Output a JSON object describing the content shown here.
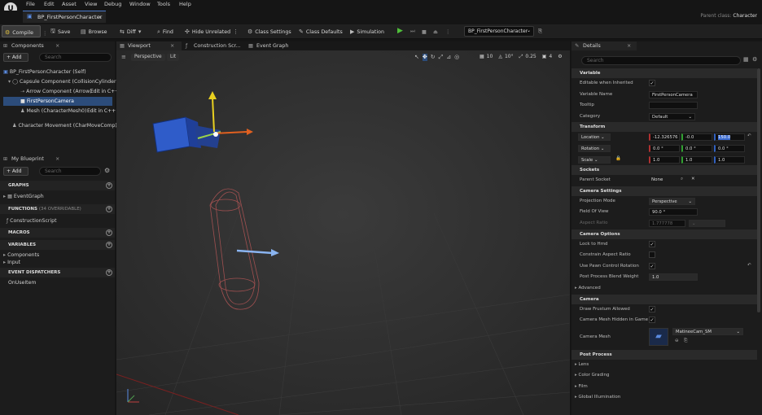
{
  "menu": [
    "File",
    "Edit",
    "Asset",
    "View",
    "Debug",
    "Window",
    "Tools",
    "Help"
  ],
  "doc_tab": {
    "label": "BP_FirstPersonCharacter",
    "close": "×"
  },
  "parent_class": {
    "label": "Parent class:",
    "value": "Character"
  },
  "toolbar": {
    "compile": "Compile",
    "save": "Save",
    "browse": "Browse",
    "diff": "Diff",
    "find": "Find",
    "hide_unrelated": "Hide Unrelated",
    "class_settings": "Class Settings",
    "class_defaults": "Class Defaults",
    "simulation": "Simulation",
    "debug_object": "BP_FirstPersonCharacter"
  },
  "components": {
    "tab": "Components",
    "add": "+ Add",
    "search_placeholder": "Search",
    "items": [
      {
        "label": "BP_FirstPersonCharacter (Self)"
      },
      {
        "label": "Capsule Component (CollisionCylinder)"
      },
      {
        "label": "Arrow Component (Arrow)",
        "link": "Edit in C++"
      },
      {
        "label": "FirstPersonCamera"
      },
      {
        "label": "Mesh (CharacterMesh0)",
        "link": "Edit in C++"
      },
      {
        "label": "Character Movement (CharMoveComp)"
      }
    ]
  },
  "my_blueprint": {
    "tab": "My Blueprint",
    "add": "+ Add",
    "search_placeholder": "Search",
    "graphs": "GRAPHS",
    "event_graph": "EventGraph",
    "functions": "FUNCTIONS",
    "functions_note": "(34 OVERRIDABLE)",
    "construction_script": "ConstructionScript",
    "macros": "MACROS",
    "variables": "VARIABLES",
    "components": "Components",
    "input": "Input",
    "event_dispatchers": "EVENT DISPATCHERS",
    "on_use_item": "OnUseItem"
  },
  "center_tabs": {
    "viewport": "Viewport",
    "construction": "Construction Scr...",
    "event_graph": "Event Graph"
  },
  "viewport": {
    "perspective": "Perspective",
    "lit": "Lit",
    "grid": "10",
    "rotation": "10°",
    "scale": "0.25",
    "camera_speed": "4"
  },
  "details": {
    "tab": "Details",
    "search_placeholder": "Search",
    "variable": "Variable",
    "editable_when_inherited": "Editable when Inherited",
    "variable_name_label": "Variable Name",
    "variable_name": "FirstPersonCamera",
    "tooltip": "Tooltip",
    "category_label": "Category",
    "category": "Default",
    "transform": "Transform",
    "location": "Location",
    "loc_x": "-12.326576",
    "loc_y": "-0.0",
    "loc_z": "150.0",
    "rotation": "Rotation",
    "rot_x": "0.0 °",
    "rot_y": "0.0 °",
    "rot_z": "0.0 °",
    "scale": "Scale",
    "scale_x": "1.0",
    "scale_y": "1.0",
    "scale_z": "1.0",
    "sockets": "Sockets",
    "parent_socket": "Parent Socket",
    "parent_socket_value": "None",
    "camera_settings": "Camera Settings",
    "projection_mode": "Projection Mode",
    "projection_value": "Perspective",
    "fov": "Field Of View",
    "fov_value": "90.0 °",
    "aspect_ratio": "Aspect Ratio",
    "aspect_value": "1.777778",
    "camera_options": "Camera Options",
    "lock_to_hmd": "Lock to Hmd",
    "constrain_aspect": "Constrain Aspect Ratio",
    "use_pawn_control": "Use Pawn Control Rotation",
    "post_process_weight": "Post Process Blend Weight",
    "post_process_weight_value": "1.0",
    "advanced": "Advanced",
    "camera": "Camera",
    "draw_frustum": "Draw Frustum Allowed",
    "camera_mesh_hidden": "Camera Mesh Hidden in Game",
    "camera_mesh": "Camera Mesh",
    "camera_mesh_value": "MatineeCam_SM",
    "post_process": "Post Process",
    "lens": "Lens",
    "color_grading": "Color Grading",
    "film": "Film",
    "global_illumination": "Global Illumination"
  }
}
